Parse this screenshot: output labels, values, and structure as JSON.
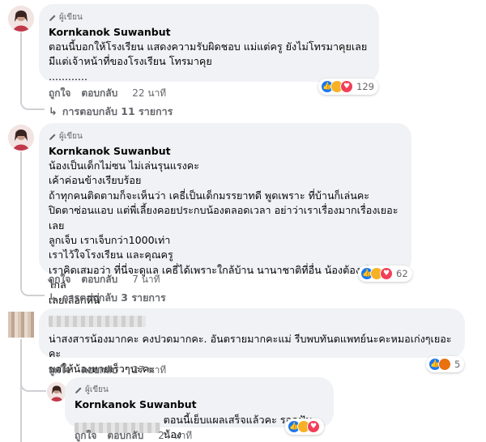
{
  "comments": [
    {
      "badge": "ผู้เขียน",
      "name": "Kornkanok Suwanbut",
      "text": "ตอนนี้บอกให้โรงเรียน แสดงความรับผิดชอบ แม่แต่ครู ยังไม่โทรมาคุยเลย\nมีแต่เจ้าหน้าที่ของโรงเรียน โทรมาคุย\n............",
      "like": "ถูกใจ",
      "reply": "ตอบกลับ",
      "time": "22 นาที",
      "reaction_count": "129",
      "replies_link": "การตอบกลับ 11 รายการ"
    },
    {
      "badge": "ผู้เขียน",
      "name": "Kornkanok Suwanbut",
      "text": "น้องเป็นเด็กไม่ซน ไม่เล่นรุนแรงคะ\nเค้าค่อนข้างเรียบร้อย\nถ้าทุกคนติดตามก็จะเห็นว่า เคธี่เป็นเด็กมรรยาทดี พูดเพราะ ที่บ้านก็เล่นคะ\nปิดตาซ่อนแอบ แต่พี่เลี้ยงคอยประกบน้องตลอดเวลา อย่าว่าเราเรื่องมากเรื่องเยอะเลย\nลูกเจ็บ เราเจ็บกว่า1000เท่า\nเราไว้ใจโรงเรียน และคุณครู\nเราคิดเสมอว่า ที่นี่จะดูแล เคธี่ได้เพราะใกล้บ้าน นานาชาติที่อื่น น้องต้องเดินทางไกล\nเลยเลือกที่นี่",
      "like": "ถูกใจ",
      "reply": "ตอบกลับ",
      "time": "7 นาที",
      "reaction_count": "62",
      "replies_link": "การตอบกลับ 3 รายการ"
    },
    {
      "text": "น่าสงสารน้องมากคะ คงปวดมากคะ. อันตรายมากคะแม่ รีบพบทันตแพทย์นะคะหมอเก่งๆเยอะคะ\nขอให้น้องหายเร็วๆนะคะ",
      "like": "ถูกใจ",
      "reply": "ตอบกลับ",
      "time": "27 นาที",
      "reaction_count": "5"
    }
  ],
  "nested_reply": {
    "badge": "ผู้เขียน",
    "name": "Kornkanok Suwanbut",
    "text": "ตอนนี้เย็บแผลเสร็จแล้วคะ รอดูฟันน้อง",
    "like": "ถูกใจ",
    "reply": "ตอบกลับ",
    "time": "24 นาที"
  },
  "icons": [
    "pencil-icon",
    "reply-arrow-icon",
    "like-reaction-icon",
    "care-reaction-icon",
    "love-reaction-icon",
    "angry-reaction-icon"
  ],
  "colors": {
    "bubble": "#f0f2f5",
    "secondary_text": "#65676b",
    "like": "#1877f2",
    "love": "#f33e58",
    "care": "#f7b125",
    "angry": "#e9710f"
  }
}
